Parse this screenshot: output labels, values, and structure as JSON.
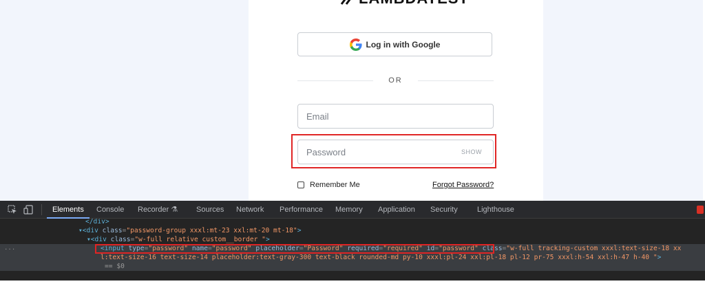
{
  "login": {
    "logo_text": "LAMBDATEST",
    "google_button": "Log in with Google",
    "or_divider": "OR",
    "email_placeholder": "Email",
    "password_placeholder": "Password",
    "show_toggle": "SHOW",
    "remember_me": "Remember Me",
    "forgot_password": "Forgot Password?"
  },
  "devtools": {
    "tabs": [
      "Elements",
      "Console",
      "Recorder",
      "Sources",
      "Network",
      "Performance",
      "Memory",
      "Application",
      "Security",
      "Lighthouse"
    ],
    "active_tab": "Elements",
    "recorder_badge": "⚗",
    "tree": {
      "line1": "</div>",
      "line2_tag_open": "<div ",
      "line2_attr": "class",
      "line2_val": "\"password-group xxxl:mt-23 xxl:mt-20 mt-18\"",
      "line2_close": ">",
      "line3_tag_open": "<div ",
      "line3_attr": "class",
      "line3_val": "\"w-full relative custom__border \"",
      "line3_close": ">",
      "line4_gutter": "...",
      "line4_tag": "<input ",
      "line4_a1": "type",
      "line4_v1": "\"password\"",
      "line4_a2": "name",
      "line4_v2": "\"password\"",
      "line4_a3": "placeholder",
      "line4_v3": "\"Password\"",
      "line4_a4": "required",
      "line4_v4": "\"required\"",
      "line4_a5": "id",
      "line4_v5": "\"password\"",
      "line4_a6": "class",
      "line4_v6a": "\"w-full tracking-custom xxxl:text-size-18 xx",
      "line5_v6b": "l:text-size-16 text-size-14 placeholder:text-gray-300 text-black rounded-md py-10 xxxl:pl-24 xxl:pl-18 pl-12 pr-75 xxxl:h-54 xxl:h-47 h-40 \"",
      "line5_close": ">",
      "line6": "== $0"
    }
  },
  "colors": {
    "highlight": "#e02424",
    "page_bg": "#f2f5fc",
    "devtools_bg": "#242424",
    "active_tab_underline": "#7cacf8"
  }
}
